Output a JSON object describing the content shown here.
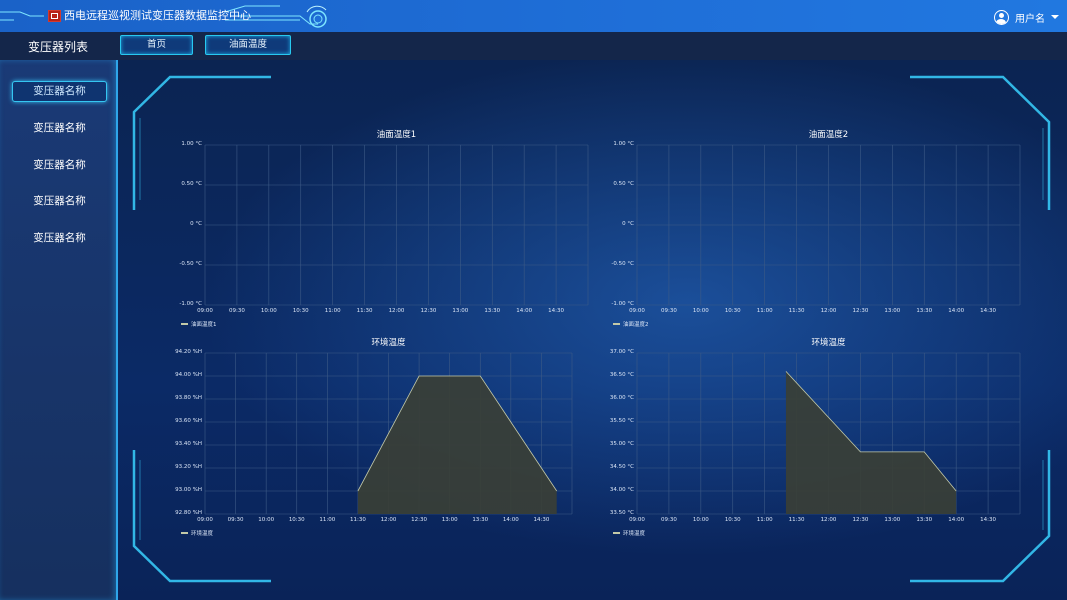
{
  "header": {
    "title": "西电远程巡视测试变压器数据监控中心",
    "user_name": "用户名"
  },
  "subbar": {
    "list_title": "变压器列表",
    "tabs": [
      {
        "label": "首页"
      },
      {
        "label": "油面温度"
      }
    ]
  },
  "sidebar": {
    "items": [
      {
        "label": "变压器名称",
        "active": true
      },
      {
        "label": "变压器名称",
        "active": false
      },
      {
        "label": "变压器名称",
        "active": false
      },
      {
        "label": "变压器名称",
        "active": false
      },
      {
        "label": "变压器名称",
        "active": false
      }
    ]
  },
  "colors": {
    "topbar": "#1f6fd8",
    "accent": "#28c9f0",
    "area_fill": "#3a3f36",
    "area_line": "#c3c9a8"
  },
  "chart_data": [
    {
      "type": "line",
      "title": "油面温度1",
      "x": [
        "09:00",
        "09:30",
        "10:00",
        "10:30",
        "11:00",
        "11:30",
        "12:00",
        "12:30",
        "13:00",
        "13:30",
        "14:00",
        "14:30"
      ],
      "yticks": [
        "1.00 °C",
        "0.50 °C",
        "0 °C",
        "-0.50 °C",
        "-1.00 °C"
      ],
      "ylim": [
        -1,
        1
      ],
      "series": [
        {
          "name": "油面温度1",
          "points": []
        }
      ],
      "legend": "bottom-left",
      "grid": true
    },
    {
      "type": "line",
      "title": "油面温度2",
      "x": [
        "09:00",
        "09:30",
        "10:00",
        "10:30",
        "11:00",
        "11:30",
        "12:00",
        "12:30",
        "13:00",
        "13:30",
        "14:00",
        "14:30"
      ],
      "yticks": [
        "1.00 °C",
        "0.50 °C",
        "0 °C",
        "-0.50 °C",
        "-1.00 °C"
      ],
      "ylim": [
        -1,
        1
      ],
      "series": [
        {
          "name": "油面温度2",
          "points": []
        }
      ],
      "legend": "bottom-left",
      "grid": true
    },
    {
      "type": "area",
      "title": "环境温度",
      "x": [
        "09:00",
        "09:30",
        "10:00",
        "10:30",
        "11:00",
        "11:30",
        "12:00",
        "12:30",
        "13:00",
        "13:30",
        "14:00",
        "14:30"
      ],
      "yticks": [
        "94.20 %H",
        "94.00 %H",
        "93.80 %H",
        "93.60 %H",
        "93.40 %H",
        "93.20 %H",
        "93.00 %H",
        "92.80 %H"
      ],
      "ylim": [
        92.8,
        94.2
      ],
      "series": [
        {
          "name": "环境温度",
          "points": [
            [
              "11:30",
              93.0
            ],
            [
              "12:30",
              94.0
            ],
            [
              "13:30",
              94.0
            ],
            [
              "14:45",
              93.0
            ]
          ]
        }
      ],
      "legend": "bottom-left",
      "grid": true
    },
    {
      "type": "area",
      "title": "环境温度",
      "x": [
        "09:00",
        "09:30",
        "10:00",
        "10:30",
        "11:00",
        "11:30",
        "12:00",
        "12:30",
        "13:00",
        "13:30",
        "14:00",
        "14:30"
      ],
      "yticks": [
        "37.00 °C",
        "36.50 °C",
        "36.00 °C",
        "35.50 °C",
        "35.00 °C",
        "34.50 °C",
        "34.00 °C",
        "33.50 °C"
      ],
      "ylim": [
        33.5,
        37.0
      ],
      "series": [
        {
          "name": "环境温度",
          "points": [
            [
              "11:20",
              36.6
            ],
            [
              "12:30",
              34.85
            ],
            [
              "13:30",
              34.85
            ],
            [
              "14:00",
              34.0
            ]
          ]
        }
      ],
      "legend": "bottom-left",
      "grid": true
    }
  ]
}
